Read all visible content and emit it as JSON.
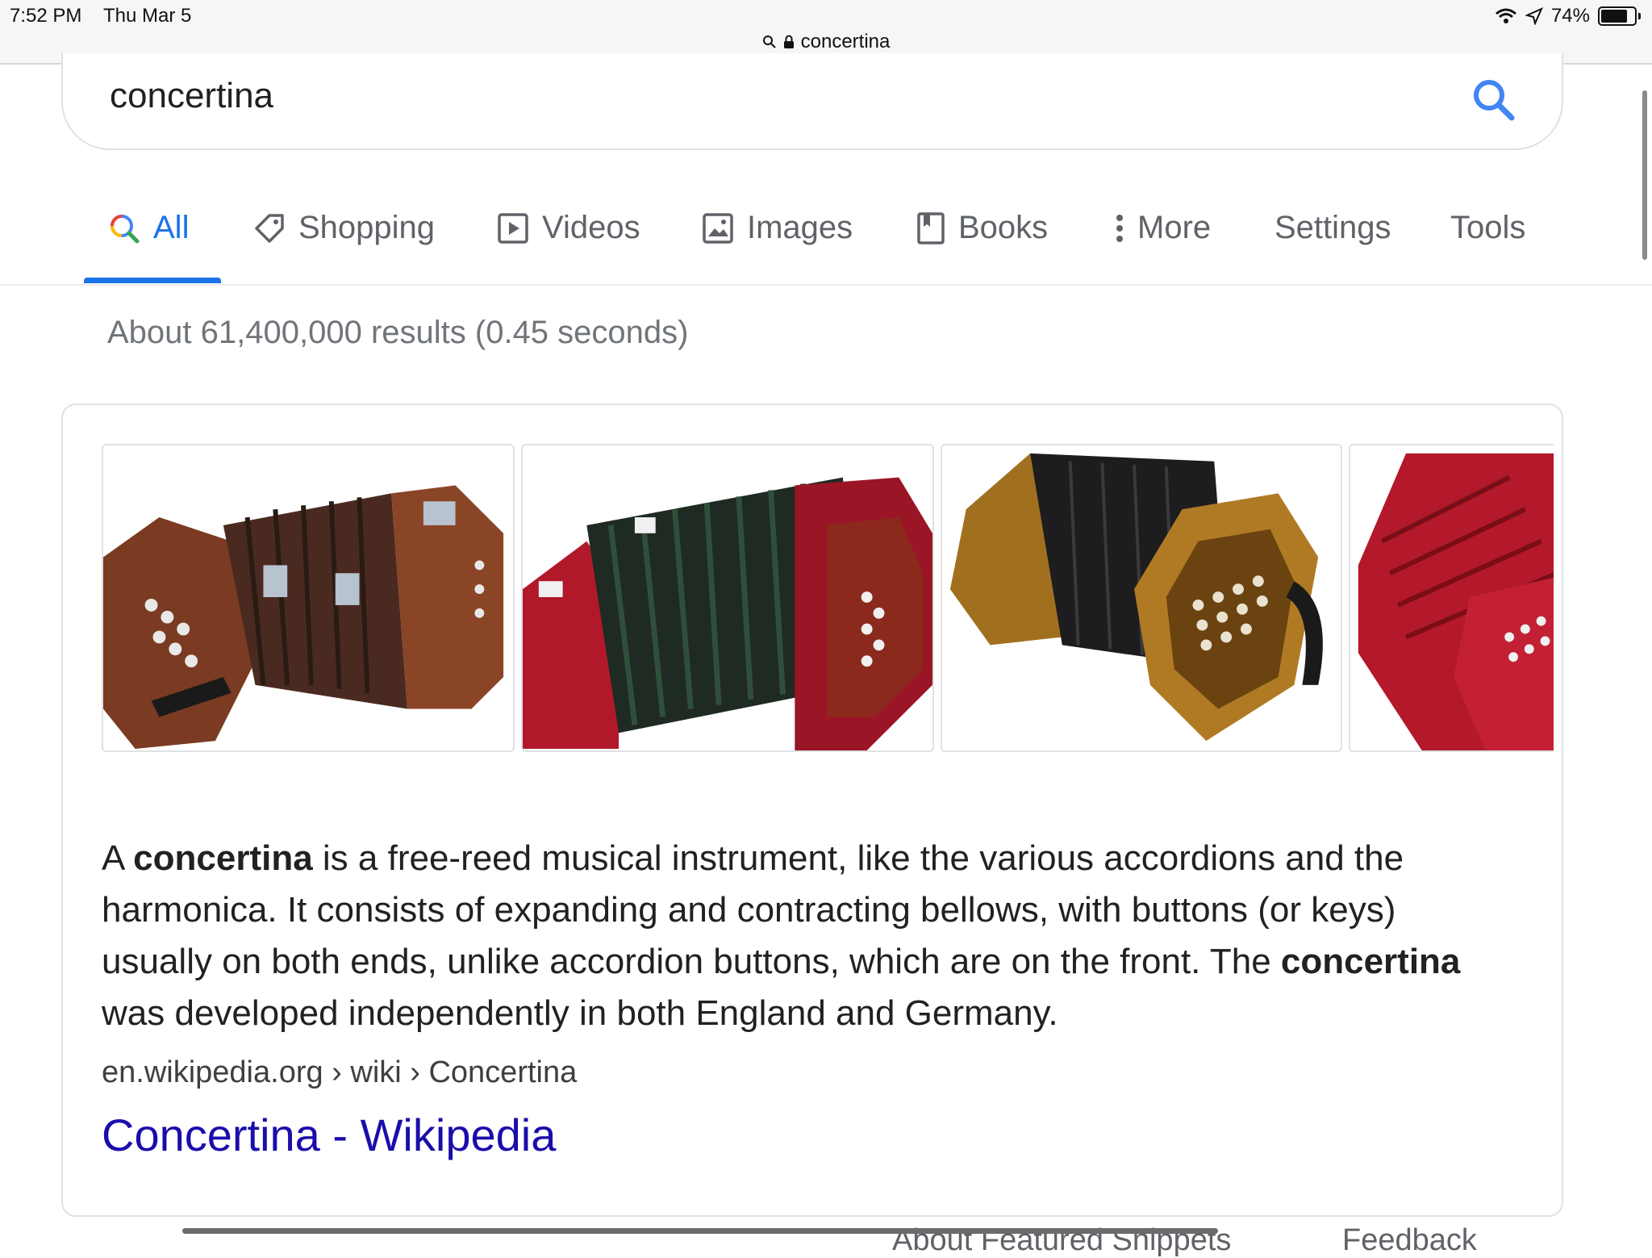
{
  "status": {
    "time": "7:52 PM",
    "date": "Thu Mar 5",
    "battery": "74%",
    "url": "concertina"
  },
  "search": {
    "query": "concertina"
  },
  "tabs": [
    {
      "label": "All",
      "icon": "search-color-icon"
    },
    {
      "label": "Shopping",
      "icon": "tag-icon"
    },
    {
      "label": "Videos",
      "icon": "play-icon"
    },
    {
      "label": "Images",
      "icon": "image-icon"
    },
    {
      "label": "Books",
      "icon": "book-icon"
    },
    {
      "label": "More",
      "icon": "more-vert-icon"
    },
    {
      "label": "Settings"
    },
    {
      "label": "Tools"
    }
  ],
  "result_stats": "About 61,400,000 results (0.45 seconds)",
  "card": {
    "images": [
      {
        "alt": "concertina",
        "colors": [
          "#7a3b22",
          "#4a2a20",
          "#b7c3cf"
        ]
      },
      {
        "alt": "concertina",
        "colors": [
          "#b1192a",
          "#1f2a22",
          "#e6e6e6"
        ]
      },
      {
        "alt": "concertina",
        "colors": [
          "#a0701e",
          "#1d1d1f",
          "#e9e2cf"
        ]
      },
      {
        "alt": "concertina",
        "colors": [
          "#b4182b",
          "#7a0d18",
          "#f0f0f0"
        ]
      }
    ],
    "snippet": {
      "p1": "A ",
      "b1": "concertina",
      "p2": " is a free-reed musical instrument, like the various accordions and the harmonica. It consists of expanding and contracting bellows, with buttons (or keys) usually on both ends, unlike accordion buttons, which are on the front. The ",
      "b2": "concertina",
      "p3": " was developed independently in both England and Germany."
    },
    "breadcrumb": "en.wikipedia.org › wiki › Concertina",
    "title": "Concertina - Wikipedia"
  },
  "bottom": {
    "about_label": "About Featured Snippets",
    "feedback_label": "Feedback"
  },
  "colors": {
    "accent": "#1a73e8",
    "link": "#1a0dab",
    "muted": "#70757a"
  }
}
